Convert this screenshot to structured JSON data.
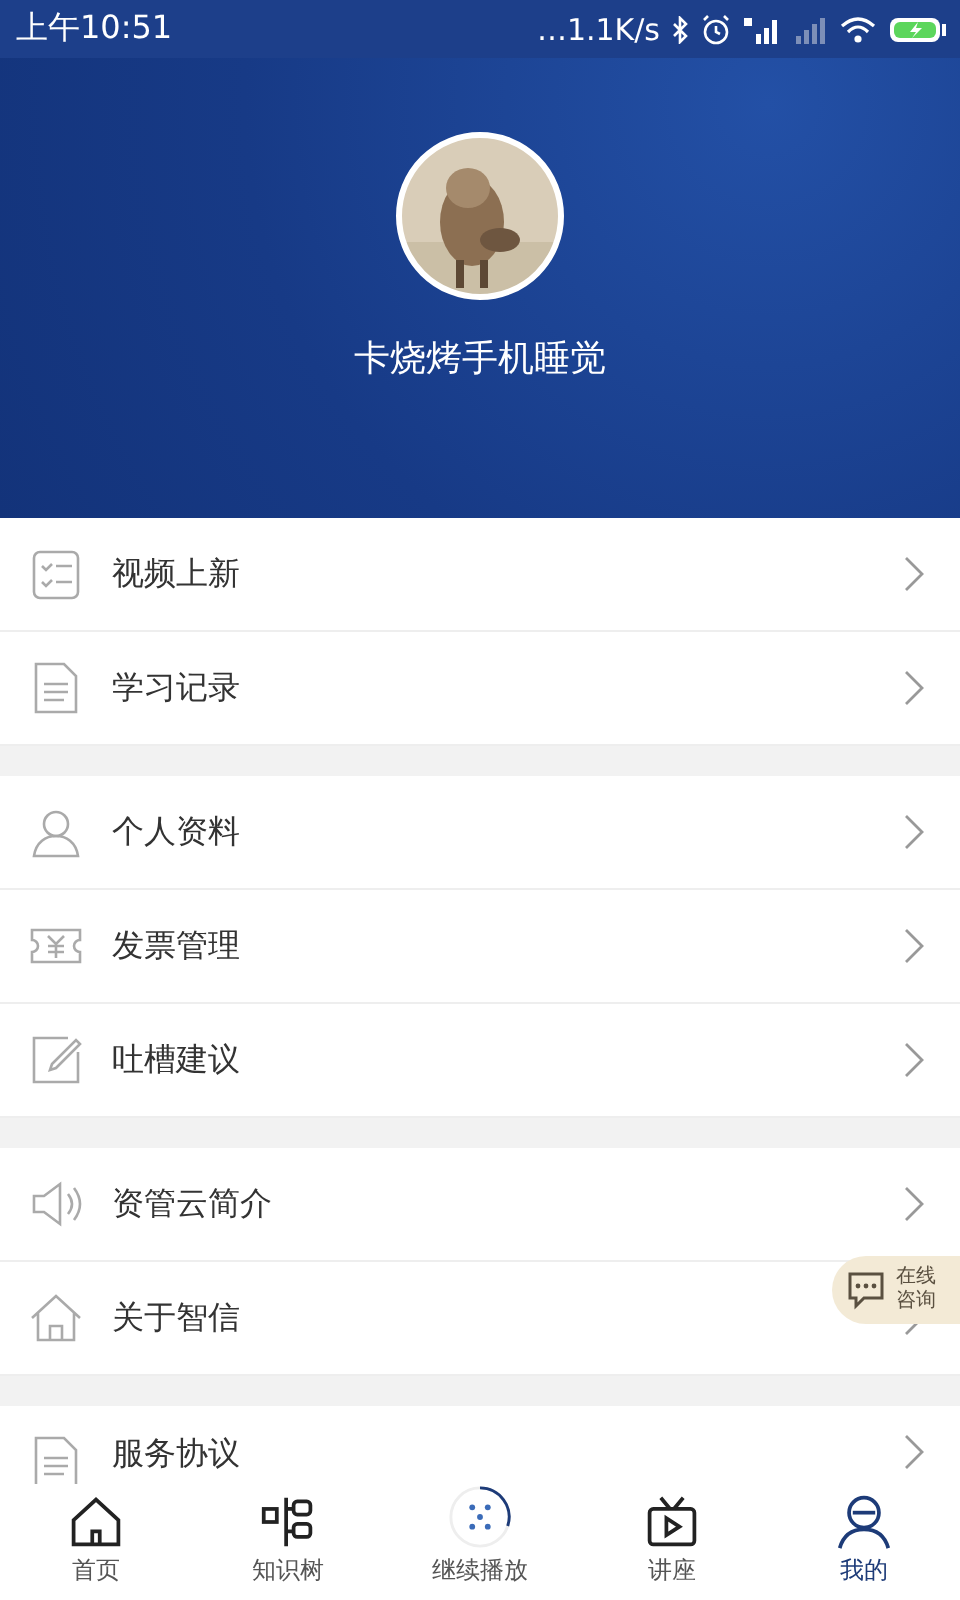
{
  "status_bar": {
    "time": "上午10:51",
    "speed": "…1.1K/s"
  },
  "profile": {
    "name": "卡烧烤手机睡觉"
  },
  "menu_groups": [
    {
      "items": [
        {
          "kind": "checklist",
          "label": "视频上新"
        },
        {
          "kind": "document",
          "label": "学习记录"
        }
      ]
    },
    {
      "items": [
        {
          "kind": "person",
          "label": "个人资料"
        },
        {
          "kind": "ticket",
          "label": "发票管理"
        },
        {
          "kind": "edit",
          "label": "吐槽建议"
        }
      ]
    },
    {
      "items": [
        {
          "kind": "speaker",
          "label": "资管云简介"
        },
        {
          "kind": "house",
          "label": "关于智信"
        }
      ]
    },
    {
      "items": [
        {
          "kind": "document",
          "label": "服务协议"
        }
      ]
    }
  ],
  "chat_bubble": {
    "line1": "在线",
    "line2": "咨询"
  },
  "tabs": [
    {
      "kind": "home",
      "label": "首页",
      "selected": false
    },
    {
      "kind": "tree",
      "label": "知识树",
      "selected": false
    },
    {
      "kind": "player",
      "label": "继续播放",
      "selected": false
    },
    {
      "kind": "tv",
      "label": "讲座",
      "selected": false
    },
    {
      "kind": "user",
      "label": "我的",
      "selected": true
    }
  ]
}
